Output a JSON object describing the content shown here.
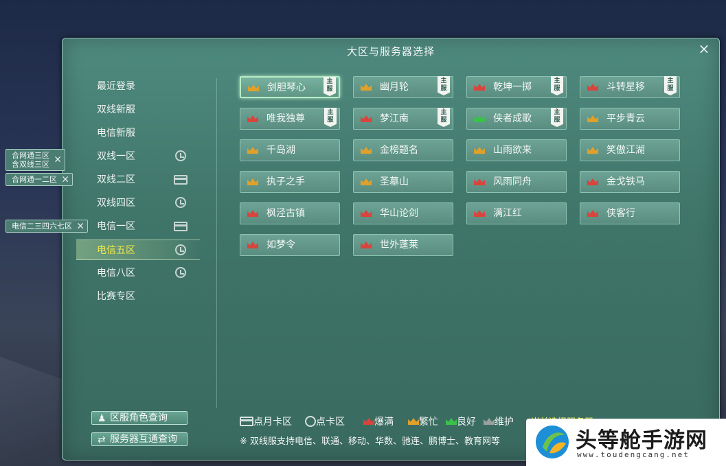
{
  "dialog": {
    "title": "大区与服务器选择",
    "close": "×"
  },
  "regions": [
    {
      "label": "最近登录",
      "icon": "",
      "selected": false
    },
    {
      "label": "双线新服",
      "icon": "",
      "selected": false
    },
    {
      "label": "电信新服",
      "icon": "",
      "selected": false
    },
    {
      "label": "双线一区",
      "icon": "clock",
      "selected": false
    },
    {
      "label": "双线二区",
      "icon": "card",
      "selected": false
    },
    {
      "label": "双线四区",
      "icon": "clock",
      "selected": false
    },
    {
      "label": "电信一区",
      "icon": "card",
      "selected": false
    },
    {
      "label": "电信五区",
      "icon": "clock",
      "selected": true
    },
    {
      "label": "电信八区",
      "icon": "clock",
      "selected": false
    },
    {
      "label": "比赛专区",
      "icon": "",
      "selected": false
    }
  ],
  "merge_tags": [
    {
      "text": "合网通三区\n含双线三区",
      "x": "×"
    },
    {
      "text": "合网通一二区",
      "x": "×"
    },
    {
      "text": "电信二三四六七区",
      "x": "×"
    }
  ],
  "servers": [
    {
      "name": "剑胆琴心",
      "status": "busy",
      "badge": "主\n服",
      "selected": true
    },
    {
      "name": "幽月轮",
      "status": "busy",
      "badge": "主\n服",
      "selected": false
    },
    {
      "name": "乾坤一掷",
      "status": "full",
      "badge": "主\n服",
      "selected": false
    },
    {
      "name": "斗转星移",
      "status": "full",
      "badge": "主\n服",
      "selected": false
    },
    {
      "name": "唯我独尊",
      "status": "full",
      "badge": "主\n服",
      "selected": false
    },
    {
      "name": "梦江南",
      "status": "full",
      "badge": "主\n服",
      "selected": false
    },
    {
      "name": "侠者成歌",
      "status": "good",
      "badge": "主\n服",
      "selected": false
    },
    {
      "name": "平步青云",
      "status": "busy",
      "badge": "",
      "selected": false
    },
    {
      "name": "千岛湖",
      "status": "busy",
      "badge": "",
      "selected": false
    },
    {
      "name": "金榜题名",
      "status": "busy",
      "badge": "",
      "selected": false
    },
    {
      "name": "山雨欲来",
      "status": "busy",
      "badge": "",
      "selected": false
    },
    {
      "name": "笑傲江湖",
      "status": "busy",
      "badge": "",
      "selected": false
    },
    {
      "name": "执子之手",
      "status": "busy",
      "badge": "",
      "selected": false
    },
    {
      "name": "圣墓山",
      "status": "busy",
      "badge": "",
      "selected": false
    },
    {
      "name": "风雨同舟",
      "status": "full",
      "badge": "",
      "selected": false
    },
    {
      "name": "金戈铁马",
      "status": "full",
      "badge": "",
      "selected": false
    },
    {
      "name": "枫泾古镇",
      "status": "full",
      "badge": "",
      "selected": false
    },
    {
      "name": "华山论剑",
      "status": "full",
      "badge": "",
      "selected": false
    },
    {
      "name": "满江红",
      "status": "full",
      "badge": "",
      "selected": false
    },
    {
      "name": "侠客行",
      "status": "full",
      "badge": "",
      "selected": false
    },
    {
      "name": "如梦令",
      "status": "full",
      "badge": "",
      "selected": false
    },
    {
      "name": "世外蓬莱",
      "status": "full",
      "badge": "",
      "selected": false
    }
  ],
  "status_colors": {
    "full": "#d9443c",
    "busy": "#e0a02a",
    "good": "#39c24a",
    "maintenance": "#9aa09e"
  },
  "buttons": {
    "role_query": "区服角色查询",
    "server_query": "服务器互通查询"
  },
  "legend": {
    "monthly": "点月卡区",
    "point": "点卡区",
    "full": "爆满",
    "busy": "繁忙",
    "good": "良好",
    "maintenance": "维护"
  },
  "note": "※ 双线服支持电信、联通、移动、华数、驰连、鹏博士、教育网等",
  "overflow_link": "当前选择服务器为: 电信五区",
  "watermark": {
    "title": "头等舱手游网",
    "url": "www.toudengcang.net"
  }
}
